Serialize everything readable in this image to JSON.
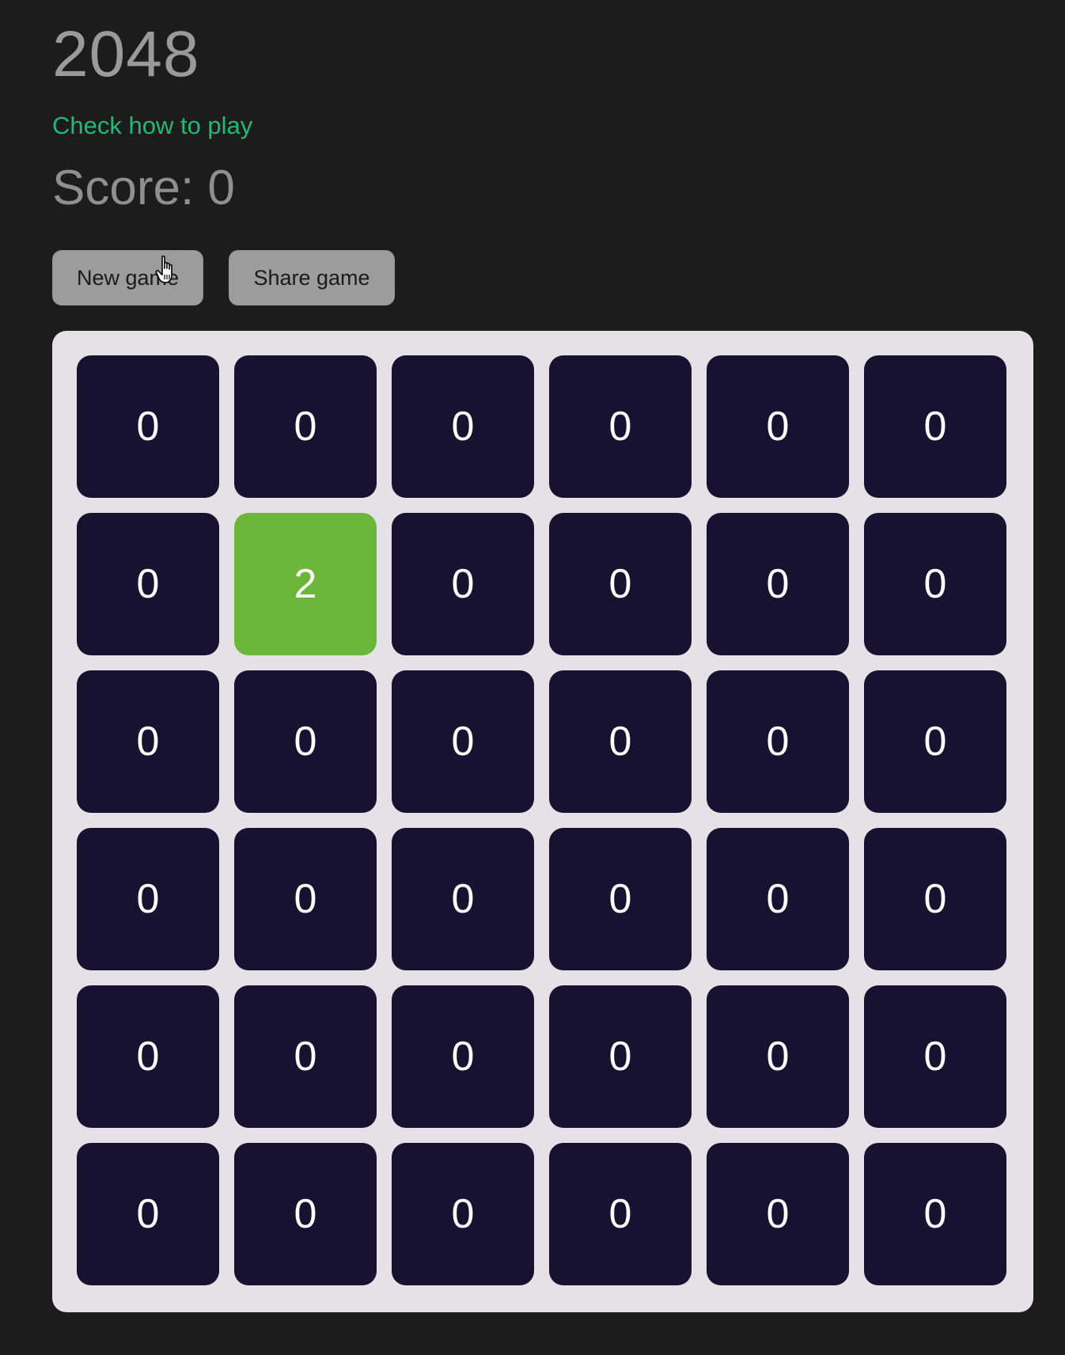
{
  "header": {
    "title": "2048",
    "how_to_play_link": "Check how to play",
    "score_text": "Score: 0"
  },
  "toolbar": {
    "new_game_label": "New game",
    "share_game_label": "Share game"
  },
  "board": {
    "rows": 6,
    "cols": 6,
    "cells": [
      [
        "0",
        "0",
        "0",
        "0",
        "0",
        "0"
      ],
      [
        "0",
        "2",
        "0",
        "0",
        "0",
        "0"
      ],
      [
        "0",
        "0",
        "0",
        "0",
        "0",
        "0"
      ],
      [
        "0",
        "0",
        "0",
        "0",
        "0",
        "0"
      ],
      [
        "0",
        "0",
        "0",
        "0",
        "0",
        "0"
      ],
      [
        "0",
        "0",
        "0",
        "0",
        "0",
        "0"
      ]
    ]
  },
  "colors": {
    "background": "#1c1c1c",
    "empty_tile": "#161230",
    "tile_2": "#6cb63c",
    "link": "#21b97a",
    "board_bg": "#e4e2e7"
  },
  "icons": {
    "cursor": "hand-pointer-icon"
  }
}
